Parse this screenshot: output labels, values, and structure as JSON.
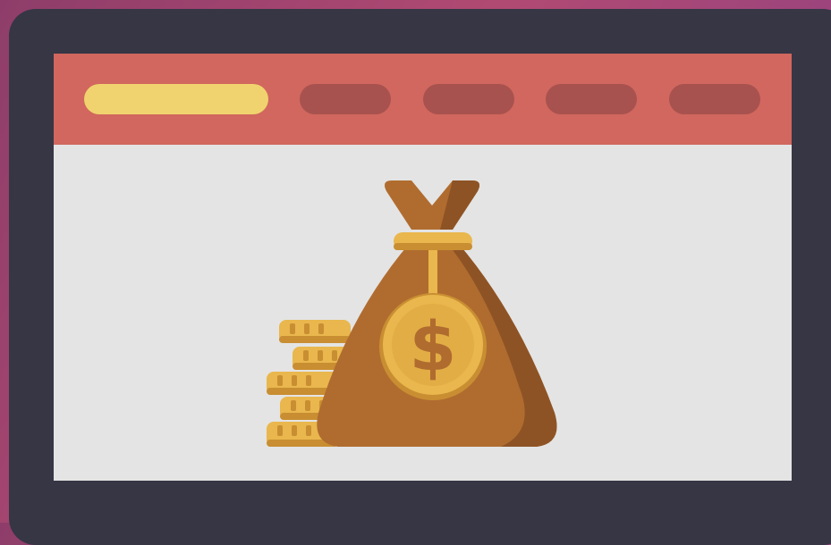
{
  "nav": {
    "items": [
      {
        "state": "active",
        "color": "#f0d36e"
      },
      {
        "state": "inactive",
        "color": "#a8524f"
      },
      {
        "state": "inactive",
        "color": "#a8524f"
      },
      {
        "state": "inactive",
        "color": "#a8524f"
      },
      {
        "state": "inactive",
        "color": "#a8524f"
      }
    ]
  },
  "illustration": {
    "subject": "money-bag-with-coins",
    "currency_symbol": "$",
    "colors": {
      "frame": "#363645",
      "nav_bar": "#d1675e",
      "content_background": "#e4e4e4",
      "bag": "#b06c2f",
      "bag_shadow": "#8e5325",
      "coin": "#e9b74d",
      "coin_shadow": "#c98e32"
    }
  }
}
